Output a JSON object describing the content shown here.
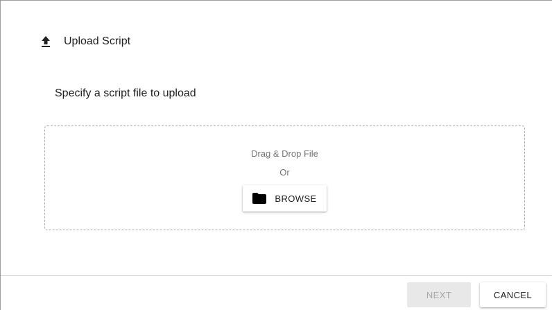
{
  "dialog": {
    "title": "Upload Script",
    "title_icon": "upload-icon"
  },
  "instruction": "Specify a script file to upload",
  "dropzone": {
    "drag_label": "Drag & Drop File",
    "or_label": "Or",
    "browse_label": "BROWSE",
    "browse_icon": "folder-icon"
  },
  "footer": {
    "next_label": "NEXT",
    "next_enabled": false,
    "cancel_label": "CANCEL"
  },
  "colors": {
    "text": "#212121",
    "muted_text": "#757575",
    "disabled_bg": "#e8e8e8",
    "disabled_text": "#a8a8a8",
    "dashed_border": "#a8a8a8"
  }
}
